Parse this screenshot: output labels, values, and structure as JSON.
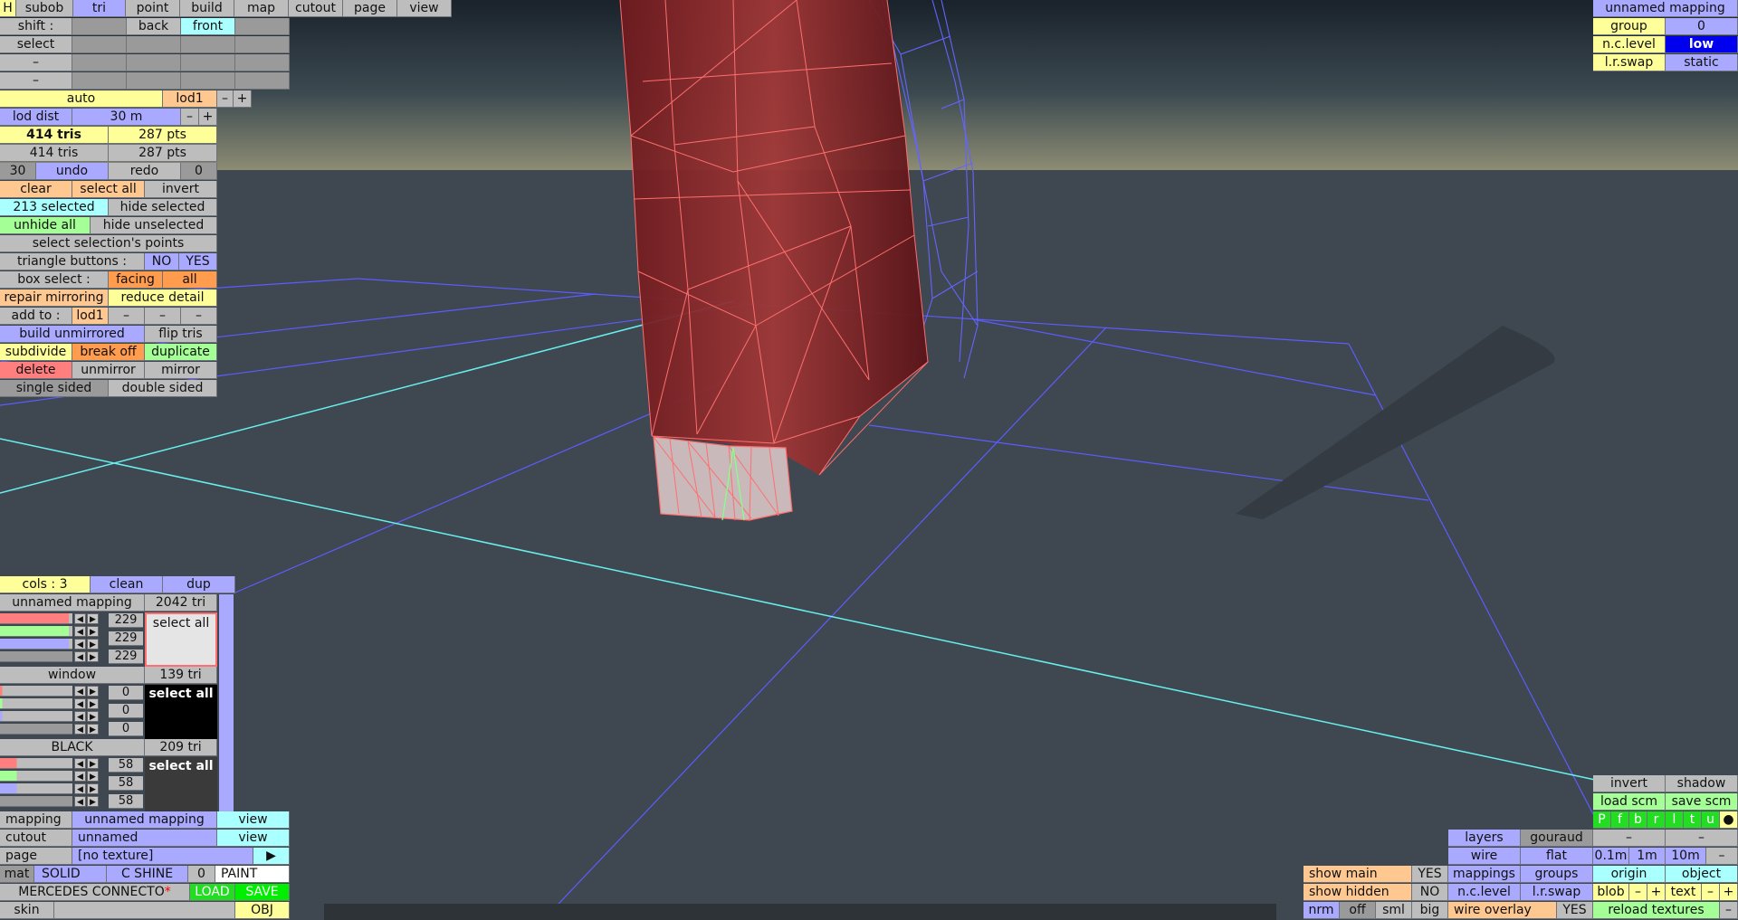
{
  "top_tabs": [
    "H",
    "subob",
    "tri",
    "point",
    "build",
    "map",
    "cutout",
    "page",
    "view"
  ],
  "left": {
    "shift_label": "shift :",
    "back": "back",
    "front": "front",
    "select_label": "select",
    "dash": "–",
    "auto": "auto",
    "lod1": "lod1",
    "minus": "–",
    "plus": "+",
    "lod_dist": "lod dist",
    "lod_dist_val": "30 m",
    "tris_a": "414 tris",
    "pts_a": "287 pts",
    "tris_b": "414 tris",
    "pts_b": "287 pts",
    "undo_count": "30",
    "undo": "undo",
    "redo": "redo",
    "redo_count": "0",
    "clear": "clear",
    "select_all": "select all",
    "invert": "invert",
    "selected_count": "213 selected",
    "hide_selected": "hide selected",
    "unhide_all": "unhide all",
    "hide_unselected": "hide unselected",
    "select_points": "select selection's points",
    "tri_buttons": "triangle buttons :",
    "no": "NO",
    "yes": "YES",
    "box_select": "box select :",
    "facing": "facing",
    "all": "all",
    "repair_mirroring": "repair mirroring",
    "reduce_detail": "reduce detail",
    "add_to": "add to :",
    "add_lod1": "lod1",
    "build_unmirrored": "build unmirrored",
    "flip_tris": "flip tris",
    "subdivide": "subdivide",
    "break_off": "break off",
    "duplicate": "duplicate",
    "delete": "delete",
    "unmirror": "unmirror",
    "mirror": "mirror",
    "single_sided": "single sided",
    "double_sided": "double sided"
  },
  "materials": {
    "cols": "cols : 3",
    "clean": "clean",
    "dup": "dup",
    "items": [
      {
        "name": "unnamed mapping",
        "tris": "2042 tri",
        "values": [
          "229",
          "229",
          "229"
        ],
        "swatch": "select all"
      },
      {
        "name": "window",
        "tris": "139 tri",
        "values": [
          "0",
          "0",
          "0"
        ],
        "swatch": "select all"
      },
      {
        "name": "BLACK",
        "tris": "209 tri",
        "values": [
          "58",
          "58",
          "58"
        ],
        "swatch": "select all"
      }
    ]
  },
  "bottom_left": {
    "mapping_label": "mapping",
    "mapping_val": "unnamed mapping",
    "view": "view",
    "cutout_label": "cutout",
    "cutout_val": "unnamed",
    "page_label": "page",
    "page_val": "[no texture]",
    "page_arrow": "▶",
    "mat": "mat",
    "solid": "SOLID",
    "cshine": "C SHINE",
    "zero": "0",
    "paint": "PAINT",
    "model_name": "MERCEDES CONNECTO",
    "dirty_mark": "*",
    "load": "LOAD",
    "save": "SAVE",
    "skin": "skin",
    "obj": "OBJ"
  },
  "top_right": {
    "mapping": "unnamed mapping",
    "group": "group",
    "group_val": "0",
    "nclevel": "n.c.level",
    "nclevel_val": "low",
    "lrswap": "l.r.swap",
    "lrswap_val": "static"
  },
  "bottom_right": {
    "invert": "invert",
    "shadow": "shadow",
    "load_scm": "load scm",
    "save_scm": "save scm",
    "letters": [
      "P",
      "f",
      "b",
      "r",
      "l",
      "t",
      "u",
      "●"
    ],
    "layers": "layers",
    "gouraud": "gouraud",
    "dash": "–",
    "wire": "wire",
    "flat": "flat",
    "d01": "0.1m",
    "d1": "1m",
    "d10": "10m",
    "show_main": "show main",
    "show_main_val": "YES",
    "mappings": "mappings",
    "groups": "groups",
    "origin": "origin",
    "object": "object",
    "show_hidden": "show hidden",
    "show_hidden_val": "NO",
    "nclevel": "n.c.level",
    "lrswap": "l.r.swap",
    "blob": "blob",
    "minus": "–",
    "plus": "+",
    "text": "text",
    "nrm": "nrm",
    "off": "off",
    "sml": "sml",
    "big": "big",
    "wire_overlay": "wire overlay",
    "wire_overlay_val": "YES",
    "reload": "reload textures"
  }
}
